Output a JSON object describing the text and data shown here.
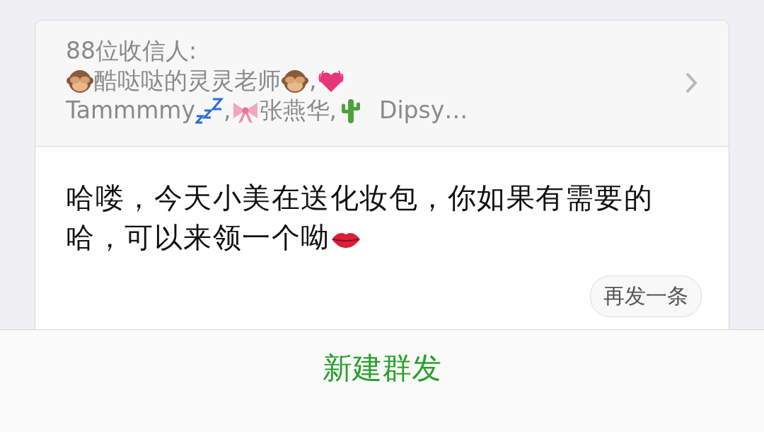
{
  "broadcast": {
    "recipient_count": "88位收信人:",
    "recipient_texts": [
      "酷哒哒的灵灵老师",
      ",",
      "Tammmmy",
      ",",
      "张燕华,",
      "Dipsy…"
    ],
    "message": "哈喽，今天小美在送化妆包，你如果有需要的哈，可以来领一个呦",
    "resend_button": "再发一条"
  },
  "new_broadcast_button": "新建群发"
}
